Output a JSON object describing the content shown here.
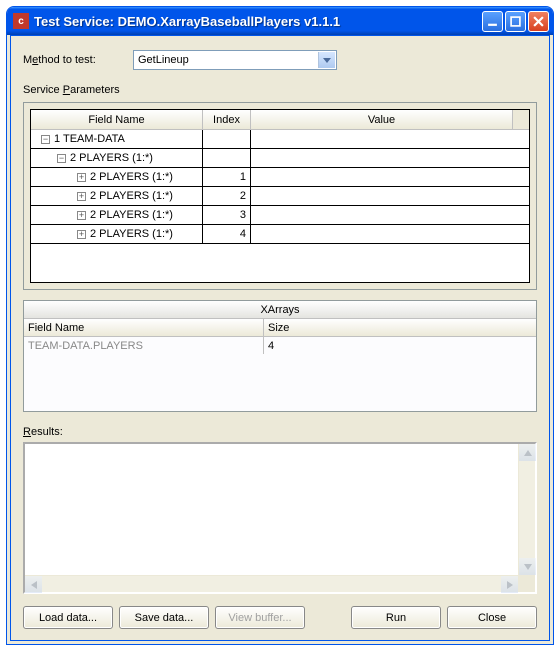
{
  "window": {
    "title": "Test Service: DEMO.XarrayBaseballPlayers v1.1.1",
    "app_icon_letter": "c"
  },
  "method_row": {
    "label_pre": "M",
    "label_underlined": "e",
    "label_post": "thod to test:",
    "selected": "GetLineup"
  },
  "service_params": {
    "label_pre": "Service ",
    "label_underlined": "P",
    "label_post": "arameters",
    "columns": {
      "field": "Field Name",
      "index": "Index",
      "value": "Value"
    },
    "rows": [
      {
        "level": 0,
        "expander": "−",
        "label": "1 TEAM-DATA",
        "index": "",
        "value": ""
      },
      {
        "level": 1,
        "expander": "−",
        "label": "2 PLAYERS (1:*)",
        "index": "",
        "value": ""
      },
      {
        "level": 2,
        "expander": "+",
        "label": "2 PLAYERS (1:*)",
        "index": "1",
        "value": ""
      },
      {
        "level": 2,
        "expander": "+",
        "label": "2 PLAYERS (1:*)",
        "index": "2",
        "value": ""
      },
      {
        "level": 2,
        "expander": "+",
        "label": "2 PLAYERS (1:*)",
        "index": "3",
        "value": ""
      },
      {
        "level": 2,
        "expander": "+",
        "label": "2 PLAYERS (1:*)",
        "index": "4",
        "value": ""
      }
    ]
  },
  "xarrays": {
    "title": "XArrays",
    "columns": {
      "name": "Field Name",
      "size": "Size"
    },
    "row": {
      "name": "TEAM-DATA.PLAYERS",
      "size": "4"
    }
  },
  "results": {
    "label_underlined": "R",
    "label_post": "esults:"
  },
  "buttons": {
    "load": "Load data...",
    "save": "Save data...",
    "view": "View buffer...",
    "run": "Run",
    "close": "Close"
  }
}
